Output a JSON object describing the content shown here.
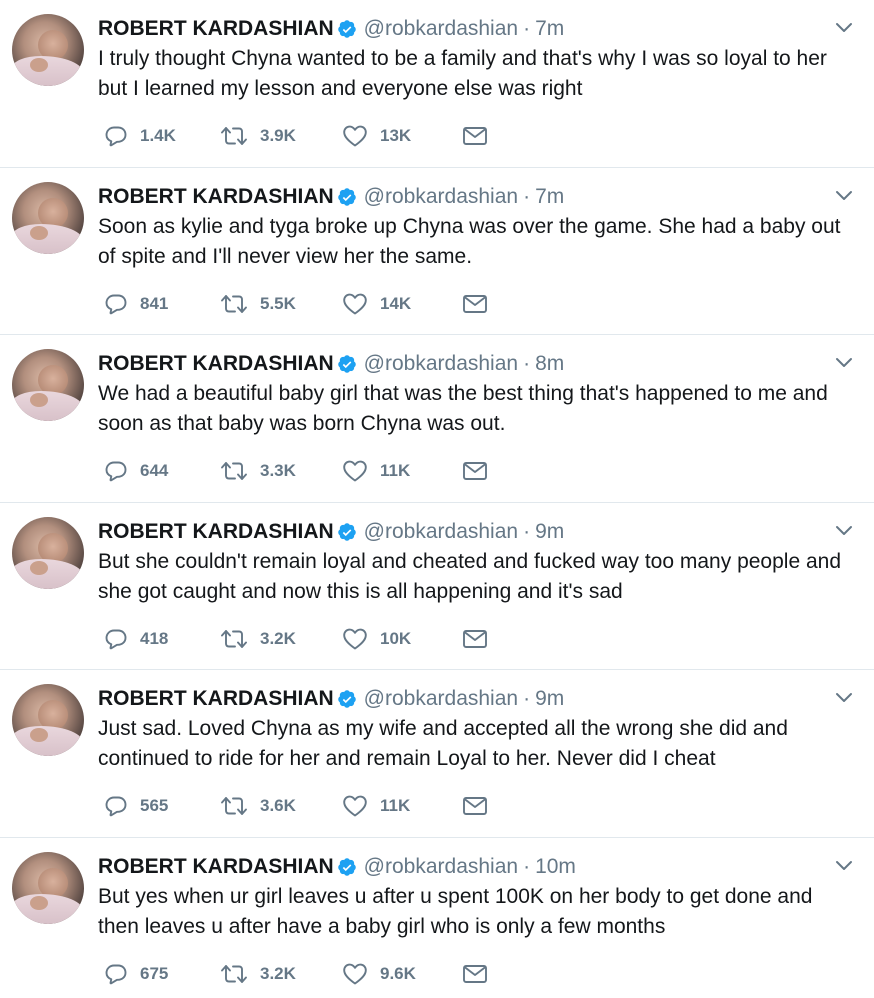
{
  "tweets": [
    {
      "name": "ROBERT KARDASHIAN",
      "handle": "@robkardashian",
      "separator": "·",
      "time": "7m",
      "text": "I truly thought Chyna wanted to be a family and that's why I was so loyal to her but I learned my lesson and everyone else was right",
      "replies": "1.4K",
      "retweets": "3.9K",
      "likes": "13K"
    },
    {
      "name": "ROBERT KARDASHIAN",
      "handle": "@robkardashian",
      "separator": "·",
      "time": "7m",
      "text": "Soon as kylie and tyga broke up Chyna was over the game. She had a baby out of spite and I'll never view her the same.",
      "replies": "841",
      "retweets": "5.5K",
      "likes": "14K"
    },
    {
      "name": "ROBERT KARDASHIAN",
      "handle": "@robkardashian",
      "separator": "·",
      "time": "8m",
      "text": "We had a beautiful baby girl that was the best thing that's happened to me and soon as that baby was born Chyna was out.",
      "replies": "644",
      "retweets": "3.3K",
      "likes": "11K"
    },
    {
      "name": "ROBERT KARDASHIAN",
      "handle": "@robkardashian",
      "separator": "·",
      "time": "9m",
      "text": "But she couldn't remain loyal and cheated and fucked way too many people and she got caught and now this is all happening and it's sad",
      "replies": "418",
      "retweets": "3.2K",
      "likes": "10K"
    },
    {
      "name": "ROBERT KARDASHIAN",
      "handle": "@robkardashian",
      "separator": "·",
      "time": "9m",
      "text": "Just sad. Loved Chyna as my wife and accepted all the wrong she did and continued to ride for her and remain Loyal to her. Never did I cheat",
      "replies": "565",
      "retweets": "3.6K",
      "likes": "11K"
    },
    {
      "name": "ROBERT KARDASHIAN",
      "handle": "@robkardashian",
      "separator": "·",
      "time": "10m",
      "text": "But yes when ur girl leaves u after u spent 100K on her body to get done and then leaves u after have a baby girl who is only a few months",
      "replies": "675",
      "retweets": "3.2K",
      "likes": "9.6K"
    }
  ],
  "icons": {
    "verified": "verified-badge-icon",
    "caret": "chevron-down-icon",
    "reply": "reply-icon",
    "retweet": "retweet-icon",
    "like": "heart-icon",
    "dm": "envelope-icon"
  },
  "colors": {
    "verified": "#1da1f2",
    "secondary": "#657786",
    "text": "#14171a",
    "divider": "#e1e8ed"
  }
}
